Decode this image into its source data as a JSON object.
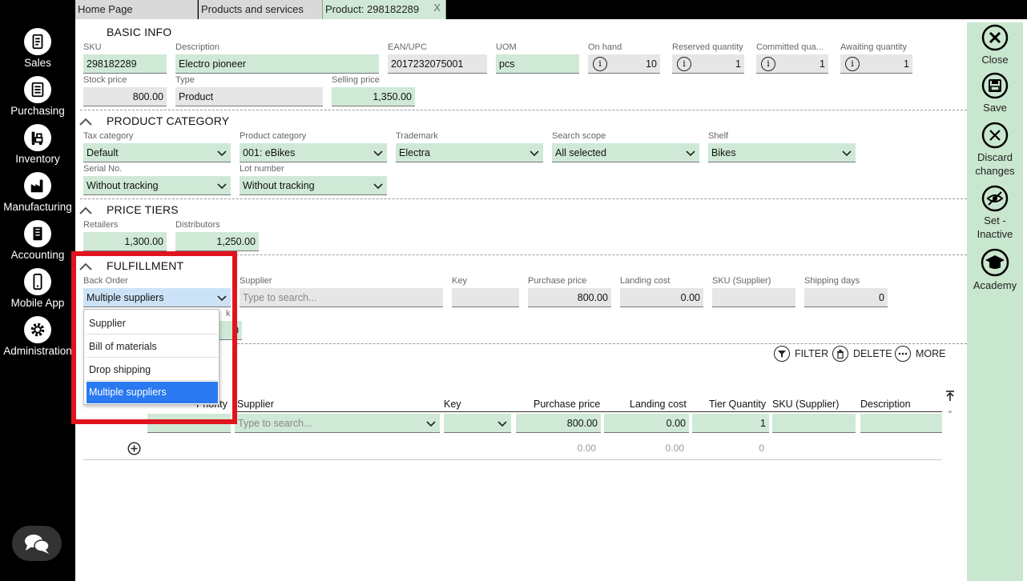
{
  "nav": {
    "items": [
      {
        "label": "Sales",
        "icon": "sales-icon"
      },
      {
        "label": "Purchasing",
        "icon": "purchasing-icon"
      },
      {
        "label": "Inventory",
        "icon": "inventory-icon"
      },
      {
        "label": "Manufacturing",
        "icon": "manufacturing-icon"
      },
      {
        "label": "Accounting",
        "icon": "accounting-icon"
      },
      {
        "label": "Mobile App",
        "icon": "mobile-app-icon"
      },
      {
        "label": "Administration",
        "icon": "administration-icon"
      }
    ]
  },
  "tabs": [
    {
      "label": "Home Page"
    },
    {
      "label": "Products and services"
    },
    {
      "label": "Product: 298182289",
      "close": "X"
    }
  ],
  "toolbar": {
    "close": "Close",
    "save": "Save",
    "discard": "Discard changes",
    "inactive": "Set - Inactive",
    "academy": "Academy"
  },
  "basic": {
    "title": "BASIC INFO",
    "sku_label": "SKU",
    "sku": "298182289",
    "desc_label": "Description",
    "desc": "Electro pioneer",
    "ean_label": "EAN/UPC",
    "ean": "2017232075001",
    "uom_label": "UOM",
    "uom": "pcs",
    "onhand_label": "On hand",
    "onhand": "10",
    "reserved_label": "Reserved quantity",
    "reserved": "1",
    "committed_label": "Committed qua...",
    "committed": "1",
    "awaiting_label": "Awaiting quantity",
    "awaiting": "1",
    "stock_label": "Stock price",
    "stock": "800.00",
    "type_label": "Type",
    "type": "Product",
    "selling_label": "Selling price",
    "selling": "1,350.00"
  },
  "category": {
    "title": "PRODUCT CATEGORY",
    "tax_label": "Tax category",
    "tax": "Default",
    "pcat_label": "Product category",
    "pcat": "001: eBikes",
    "trademark_label": "Trademark",
    "trademark": "Electra",
    "scope_label": "Search scope",
    "scope": "All selected",
    "shelf_label": "Shelf",
    "shelf": "Bikes",
    "serial_label": "Serial No.",
    "serial": "Without tracking",
    "lot_label": "Lot number",
    "lot": "Without tracking"
  },
  "tiers": {
    "title": "PRICE TIERS",
    "retail_label": "Retailers",
    "retail": "1,300.00",
    "dist_label": "Distributors",
    "dist": "1,250.00"
  },
  "fulfillment": {
    "title": "FULFILLMENT",
    "backorder_label": "Back Order",
    "backorder": "Multiple suppliers",
    "supplier_label": "Supplier",
    "supplier_ph": "Type to search...",
    "key_label": "Key",
    "pprice_label": "Purchase price",
    "pprice": "800.00",
    "landing_label": "Landing cost",
    "landing": "0.00",
    "skusup_label": "SKU (Supplier)",
    "days_label": "Shipping days",
    "days": "0",
    "hidden_label_tail": "k",
    "hidden_value_tail": "0",
    "options": [
      "Supplier",
      "Bill of materials",
      "Drop shipping",
      "Multiple suppliers"
    ]
  },
  "actions": {
    "filter": "FILTER",
    "delete": "DELETE",
    "more": "MORE"
  },
  "grid": {
    "columns": [
      "Priority",
      "Supplier",
      "Key",
      "Purchase price",
      "Landing cost",
      "Tier Quantity",
      "SKU (Supplier)",
      "Description"
    ],
    "row": {
      "supplier_ph": "Type to search...",
      "pprice": "800.00",
      "landing": "0.00",
      "qty": "1"
    },
    "totals": {
      "pprice": "0.00",
      "landing": "0.00",
      "qty": "0"
    }
  },
  "colors": {
    "accent_green": "#cfe9d6",
    "highlight": "#e0141e",
    "selected_item": "#2a79f0"
  }
}
